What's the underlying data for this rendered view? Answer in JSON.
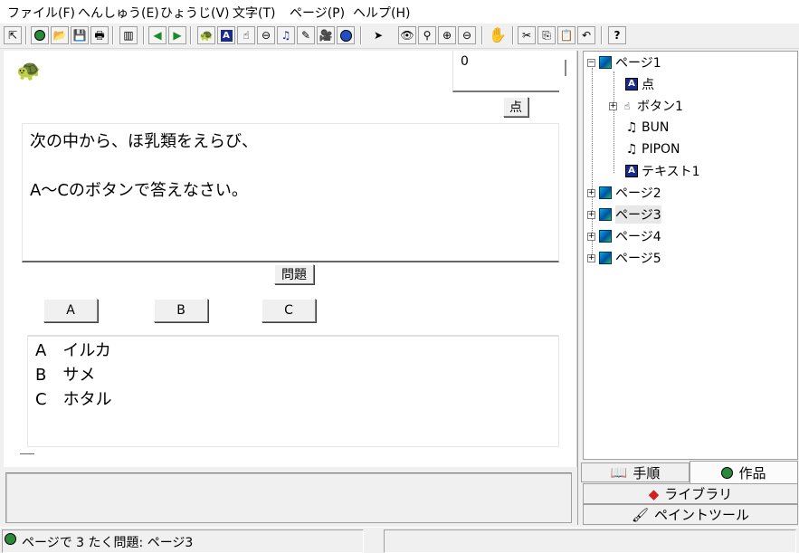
{
  "menu": [
    {
      "key": "file",
      "label": "ファイル(F)"
    },
    {
      "key": "edit",
      "label": "へんしゅう(E)"
    },
    {
      "key": "view",
      "label": "ひょうじ(V)"
    },
    {
      "key": "text",
      "label": "文字(T)"
    },
    {
      "key": "page",
      "label": "ページ(P)"
    },
    {
      "key": "help",
      "label": "ヘルプ(H)"
    }
  ],
  "toolbar": {
    "help_label": "?"
  },
  "canvas": {
    "score_value": "0",
    "score_button": "点",
    "question_text": "次の中から、ほ乳類をえらび、\n\nA〜Cのボタンで答えなさい。",
    "question_button": "問題",
    "answer_buttons": [
      "A",
      "B",
      "C"
    ],
    "choices": [
      "A　イルカ",
      "B　サメ",
      "C　ホタル"
    ]
  },
  "tree": {
    "page1": "ページ1",
    "score_label": "点",
    "button1": "ボタン1",
    "sound1": "BUN",
    "sound2": "PIPON",
    "text1": "テキスト1",
    "page2": "ページ2",
    "page3": "ページ3",
    "page4": "ページ4",
    "page5": "ページ5"
  },
  "tabs": {
    "procedure": "手順",
    "work": "作品",
    "library": "ライブラリ",
    "paint": "ペイントツール"
  },
  "status": {
    "text": "ページで 3 たく問題: ページ3"
  },
  "colors": {
    "accent_blue": "#1a2a8a",
    "canvas_bg": "#ffffff",
    "chrome_bg": "#f0f0f0"
  }
}
